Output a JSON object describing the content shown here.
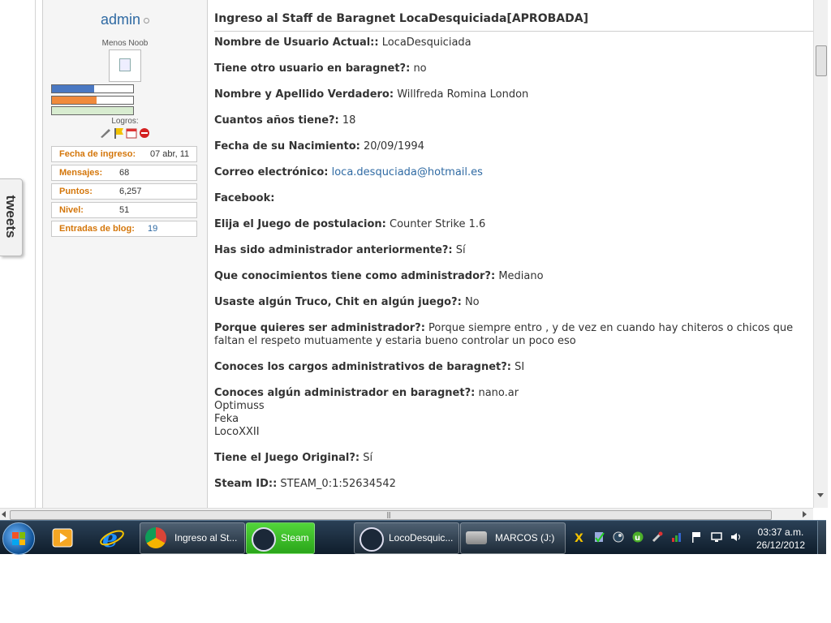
{
  "sidebar": {
    "username": "admin",
    "rank": "Menos Noob",
    "logros_label": "Logros:",
    "stats": [
      {
        "label": "Fecha de ingreso:",
        "value": "07 abr, 11"
      },
      {
        "label": "Mensajes:",
        "value": "68"
      },
      {
        "label": "Puntos:",
        "value": "6,257"
      },
      {
        "label": "Nivel:",
        "value": "51"
      },
      {
        "label": "Entradas de blog:",
        "value": "19"
      }
    ]
  },
  "post": {
    "title": "Ingreso al Staff de Baragnet LocaDesquiciada[APROBADA]",
    "fields": [
      {
        "label": "Nombre de Usuario Actual::",
        "value": "LocaDesquiciada"
      },
      {
        "label": "Tiene otro usuario en baragnet?:",
        "value": "no"
      },
      {
        "label": "Nombre y Apellido Verdadero:",
        "value": "Willfreda Romina London"
      },
      {
        "label": "Cuantos años tiene?:",
        "value": "18"
      },
      {
        "label": "Fecha de su Nacimiento:",
        "value": "20/09/1994"
      },
      {
        "label": "Correo electrónico:",
        "value": "loca.desquciada@hotmail.es"
      },
      {
        "label": "Facebook:",
        "value": ""
      },
      {
        "label": "Elija el Juego de postulacion:",
        "value": "Counter Strike 1.6"
      },
      {
        "label": "Has sido administrador anteriormente?:",
        "value": "Sí"
      },
      {
        "label": "Que conocimientos tiene como administrador?:",
        "value": "Mediano"
      },
      {
        "label": "Usaste algún Truco, Chit en algún juego?:",
        "value": "No"
      },
      {
        "label": "Porque quieres ser administrador?:",
        "value": "Porque siempre entro , y de vez en cuando hay chiteros o chicos que faltan el respeto mutuamente y estaria bueno controlar un poco eso"
      },
      {
        "label": "Conoces los cargos administrativos de baragnet?:",
        "value": "SI"
      },
      {
        "label": "Conoces algún administrador en baragnet?:",
        "value": "nano.ar",
        "extra": [
          "Optimuss",
          "Feka",
          "LocoXXII"
        ]
      },
      {
        "label": "Tiene el Juego Original?:",
        "value": "Sí"
      },
      {
        "label": "Steam ID::",
        "value": "STEAM_0:1:52634542"
      }
    ]
  },
  "tweets_tab": "tweets",
  "taskbar": {
    "tasks": [
      {
        "label": "Ingreso al St..."
      },
      {
        "label": "Steam"
      },
      {
        "label": "LocoDesquic..."
      },
      {
        "label": "MARCOS (J:)"
      }
    ],
    "clock_time": "03:37 a.m.",
    "clock_date": "26/12/2012"
  },
  "colors": {
    "link": "#2f6aa3",
    "stat_label": "#d4760a",
    "bar_blue": "#4a78c2",
    "bar_orange": "#f08a3c",
    "bar_green": "#d8ecd0"
  },
  "icons": [
    "windows-start-icon",
    "media-player-icon",
    "internet-explorer-icon",
    "chrome-icon",
    "steam-icon",
    "drive-icon",
    "norton-icon",
    "antivirus-icon",
    "steam-tray-icon",
    "utorrent-icon",
    "tools-icon",
    "network-icon",
    "flag-icon",
    "display-icon",
    "volume-icon"
  ]
}
